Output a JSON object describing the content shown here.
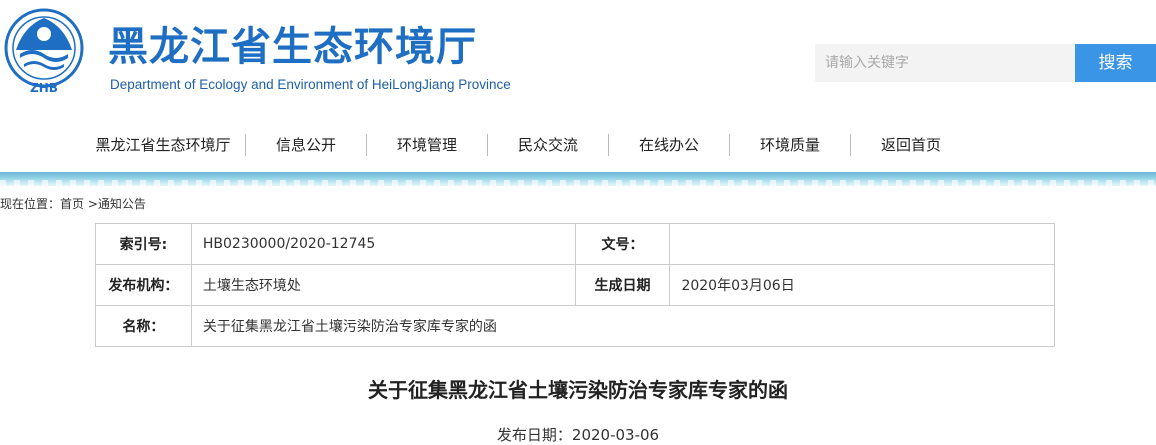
{
  "header": {
    "logo_text": "ZHB",
    "site_title": "黑龙江省生态环境厅",
    "site_subtitle": "Department of Ecology and Environment  of HeiLongJiang Province",
    "colors": {
      "title": "#1e6fc3",
      "search_button": "#3b95e6"
    }
  },
  "search": {
    "placeholder": "请输入关键字",
    "button_label": "搜索"
  },
  "nav": {
    "items": [
      {
        "label": "黑龙江省生态环境厅"
      },
      {
        "label": "信息公开"
      },
      {
        "label": "环境管理"
      },
      {
        "label": "民众交流"
      },
      {
        "label": "在线办公"
      },
      {
        "label": "环境质量"
      },
      {
        "label": "返回首页"
      }
    ]
  },
  "breadcrumb": {
    "prefix": "现在位置：",
    "home": "首页",
    "separator": " >",
    "current": "通知公告"
  },
  "info_table": {
    "index_label": "索引号:",
    "index_value": "HB0230000/2020-12745",
    "doc_no_label": "文号：",
    "doc_no_value": "",
    "org_label": "发布机构：",
    "org_value": "土壤生态环境处",
    "date_label": "生成日期",
    "date_value": "2020年03月06日",
    "name_label": "名称：",
    "name_value": "关于征集黑龙江省土壤污染防治专家库专家的函"
  },
  "article": {
    "title": "关于征集黑龙江省土壤污染防治专家库专家的函",
    "publish_date": "发布日期：2020-03-06"
  }
}
